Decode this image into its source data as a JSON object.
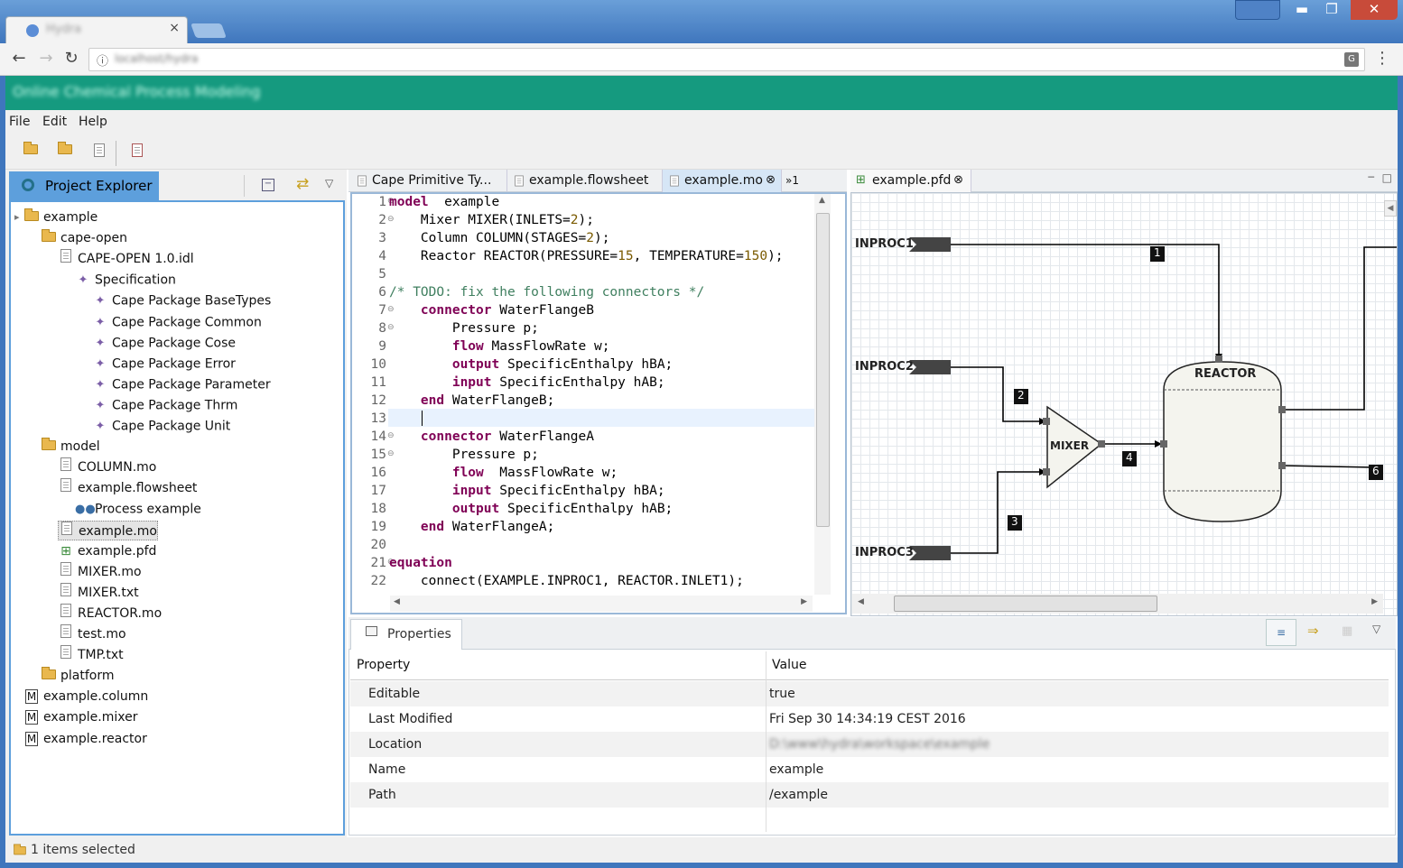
{
  "browser": {
    "tab_title": "Hydra",
    "url": "localhost/hydra",
    "close": "×"
  },
  "app": {
    "banner_title": "Online Chemical Process Modeling"
  },
  "menu": [
    "File",
    "Edit",
    "Help"
  ],
  "explorer": {
    "title": "Project Explorer",
    "tree": [
      {
        "label": "example",
        "depth": 0,
        "icon": "folder-open-icon"
      },
      {
        "label": "cape-open",
        "depth": 1,
        "icon": "folder-open-icon"
      },
      {
        "label": "CAPE-OPEN 1.0.idl",
        "depth": 2,
        "icon": "file-icon"
      },
      {
        "label": "Specification",
        "depth": 3,
        "icon": "package-icon"
      },
      {
        "label": "Cape Package BaseTypes",
        "depth": 4,
        "icon": "package-icon"
      },
      {
        "label": "Cape Package Common",
        "depth": 4,
        "icon": "package-icon"
      },
      {
        "label": "Cape Package Cose",
        "depth": 4,
        "icon": "package-icon"
      },
      {
        "label": "Cape Package Error",
        "depth": 4,
        "icon": "package-icon"
      },
      {
        "label": "Cape Package Parameter",
        "depth": 4,
        "icon": "package-icon"
      },
      {
        "label": "Cape Package Thrm",
        "depth": 4,
        "icon": "package-icon"
      },
      {
        "label": "Cape Package Unit",
        "depth": 4,
        "icon": "package-icon"
      },
      {
        "label": "model",
        "depth": 1,
        "icon": "folder-open-icon"
      },
      {
        "label": "COLUMN.mo",
        "depth": 2,
        "icon": "file-icon"
      },
      {
        "label": "example.flowsheet",
        "depth": 2,
        "icon": "file-icon"
      },
      {
        "label": "Process example",
        "depth": 3,
        "icon": "process-icon"
      },
      {
        "label": "example.mo",
        "depth": 2,
        "icon": "file-icon",
        "selected": true
      },
      {
        "label": "example.pfd",
        "depth": 2,
        "icon": "diagram-icon"
      },
      {
        "label": "MIXER.mo",
        "depth": 2,
        "icon": "file-icon"
      },
      {
        "label": "MIXER.txt",
        "depth": 2,
        "icon": "file-icon"
      },
      {
        "label": "REACTOR.mo",
        "depth": 2,
        "icon": "file-icon"
      },
      {
        "label": "test.mo",
        "depth": 2,
        "icon": "file-icon"
      },
      {
        "label": "TMP.txt",
        "depth": 2,
        "icon": "file-icon"
      },
      {
        "label": "platform",
        "depth": 1,
        "icon": "folder-open-icon"
      },
      {
        "label": "example.column",
        "depth": 0,
        "icon": "model-icon"
      },
      {
        "label": "example.mixer",
        "depth": 0,
        "icon": "model-icon"
      },
      {
        "label": "example.reactor",
        "depth": 0,
        "icon": "model-icon"
      }
    ]
  },
  "editor": {
    "tabs": [
      "Cape Primitive Ty...",
      "example.flowsheet",
      "example.mo",
      "»1"
    ],
    "active_tab": "example.mo",
    "lines": [
      [
        [
          "kw",
          "model"
        ],
        [
          "",
          "  example"
        ]
      ],
      [
        [
          "",
          "    Mixer MIXER(INLETS="
        ],
        [
          "num",
          "2"
        ],
        [
          "",
          ");"
        ]
      ],
      [
        [
          "",
          "    Column COLUMN(STAGES="
        ],
        [
          "num",
          "2"
        ],
        [
          "",
          ");"
        ]
      ],
      [
        [
          "",
          "    Reactor REACTOR(PRESSURE="
        ],
        [
          "num",
          "15"
        ],
        [
          "",
          ", TEMPERATURE="
        ],
        [
          "num",
          "150"
        ],
        [
          "",
          ");"
        ]
      ],
      [],
      [
        [
          "cm",
          "/* TODO: fix the following connectors */"
        ]
      ],
      [
        [
          "",
          "    "
        ],
        [
          "kw",
          "connector"
        ],
        [
          "",
          " WaterFlangeB"
        ]
      ],
      [
        [
          "",
          "        Pressure p;"
        ]
      ],
      [
        [
          "",
          "        "
        ],
        [
          "kw",
          "flow"
        ],
        [
          "",
          " MassFlowRate w;"
        ]
      ],
      [
        [
          "",
          "        "
        ],
        [
          "kw",
          "output"
        ],
        [
          "",
          " SpecificEnthalpy hBA;"
        ]
      ],
      [
        [
          "",
          "        "
        ],
        [
          "kw",
          "input"
        ],
        [
          "",
          " SpecificEnthalpy hAB;"
        ]
      ],
      [
        [
          "",
          "    "
        ],
        [
          "kw",
          "end"
        ],
        [
          "",
          " WaterFlangeB;"
        ]
      ],
      [],
      [
        [
          "",
          "    "
        ],
        [
          "kw",
          "connector"
        ],
        [
          "",
          " WaterFlangeA"
        ]
      ],
      [
        [
          "",
          "        Pressure p;"
        ]
      ],
      [
        [
          "",
          "        "
        ],
        [
          "kw",
          "flow"
        ],
        [
          "",
          "  MassFlowRate w;"
        ]
      ],
      [
        [
          "",
          "        "
        ],
        [
          "kw",
          "input"
        ],
        [
          "",
          " SpecificEnthalpy hBA;"
        ]
      ],
      [
        [
          "",
          "        "
        ],
        [
          "kw",
          "output"
        ],
        [
          "",
          " SpecificEnthalpy hAB;"
        ]
      ],
      [
        [
          "",
          "    "
        ],
        [
          "kw",
          "end"
        ],
        [
          "",
          " WaterFlangeA;"
        ]
      ],
      [],
      [
        [
          "kw",
          "equation"
        ]
      ],
      [
        [
          "",
          "    connect(EXAMPLE.INPROC1, REACTOR.INLET1);"
        ]
      ]
    ],
    "fold_lines": [
      1,
      2,
      7,
      8,
      14,
      15,
      21
    ]
  },
  "diagram": {
    "tab": "example.pfd",
    "inputs": [
      "INPROC1",
      "INPROC2",
      "INPROC3"
    ],
    "mixer_label": "MIXER",
    "reactor_label": "REACTOR",
    "stream_labels": [
      "1",
      "2",
      "3",
      "4",
      "6"
    ]
  },
  "properties": {
    "tab": "Properties",
    "col_property": "Property",
    "col_value": "Value",
    "rows": [
      {
        "key": "Editable",
        "value": "true"
      },
      {
        "key": "Last Modified",
        "value": "Fri Sep 30 14:34:19 CEST 2016"
      },
      {
        "key": "Location",
        "value": "D:\\www\\hydra\\workspace\\example"
      },
      {
        "key": "Name",
        "value": "example"
      },
      {
        "key": "Path",
        "value": "/example"
      }
    ]
  },
  "status": "1 items selected",
  "colors": {
    "banner": "#159a7f",
    "explorer_tab": "#5d9fdc",
    "keyword": "#7f0055",
    "comment": "#3f7f5f"
  }
}
